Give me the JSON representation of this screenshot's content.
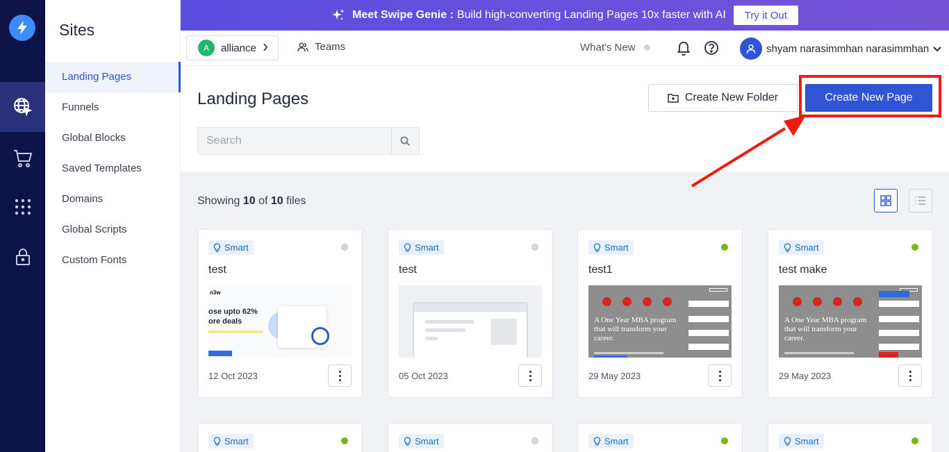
{
  "banner": {
    "headline": "Meet Swipe Genie :",
    "text": "Build high-converting Landing Pages 10x faster with AI",
    "cta": "Try it Out"
  },
  "sidebar": {
    "title": "Sites",
    "items": [
      {
        "label": "Landing Pages",
        "active": true
      },
      {
        "label": "Funnels",
        "active": false
      },
      {
        "label": "Global Blocks",
        "active": false
      },
      {
        "label": "Saved Templates",
        "active": false
      },
      {
        "label": "Domains",
        "active": false
      },
      {
        "label": "Global Scripts",
        "active": false
      },
      {
        "label": "Custom Fonts",
        "active": false
      }
    ]
  },
  "rail": {
    "icons": [
      "bolt-logo-icon",
      "globe-cursor-icon",
      "cart-icon",
      "apps-grid-icon",
      "lock-icon"
    ]
  },
  "header": {
    "workspace_initial": "A",
    "workspace_name": "alliance",
    "teams_label": "Teams",
    "whats_new": "What's New",
    "user_name": "shyam narasimmhan narasimmhan"
  },
  "page": {
    "title": "Landing Pages",
    "create_folder": "Create New Folder",
    "create_page": "Create New Page",
    "search_placeholder": "Search"
  },
  "listing": {
    "prefix": "Showing",
    "shown": "10",
    "of": "of",
    "total": "10",
    "suffix": "files"
  },
  "cards": [
    {
      "tag": "Smart",
      "title": "test",
      "date": "12 Oct 2023",
      "status": "inactive",
      "thumb": "promo",
      "thumb_text": {
        "brand": "n3w",
        "line1": "ose upto 62%",
        "line2": "ore deals"
      }
    },
    {
      "tag": "Smart",
      "title": "test",
      "date": "05 Oct 2023",
      "status": "inactive",
      "thumb": "blank"
    },
    {
      "tag": "Smart",
      "title": "test1",
      "date": "29 May 2023",
      "status": "active",
      "thumb": "mba",
      "thumb_text": {
        "headline": "A One Year MBA program that will transform your career."
      }
    },
    {
      "tag": "Smart",
      "title": "test make",
      "date": "29 May 2023",
      "status": "active",
      "thumb": "mba",
      "thumb_text": {
        "headline": "A One Year MBA program that will transform your career."
      }
    },
    {
      "tag": "Smart",
      "status": "active"
    },
    {
      "tag": "Smart",
      "status": "inactive"
    },
    {
      "tag": "Smart",
      "status": "active"
    },
    {
      "tag": "Smart",
      "status": "active"
    }
  ],
  "colors": {
    "rail": "#0d1247",
    "primary": "#2f55d4",
    "annotation_red": "#f21b0f",
    "status_active": "#7cb518",
    "status_inactive": "#d6d9de"
  }
}
